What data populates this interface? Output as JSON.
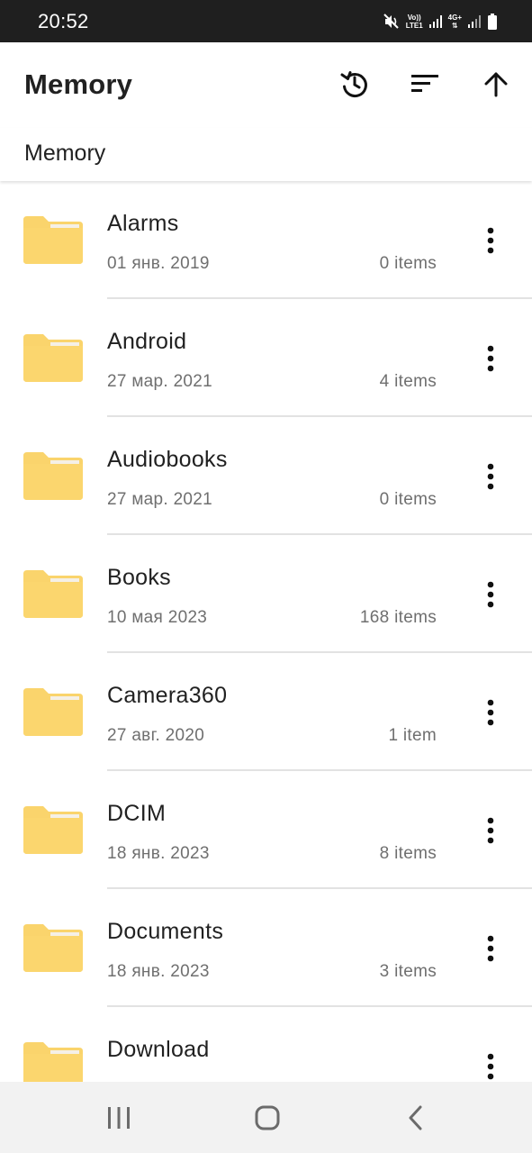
{
  "status_bar": {
    "time": "20:52",
    "network_top": "Vo))",
    "network_bottom": "LTE1",
    "network2_top": "4G+"
  },
  "app_bar": {
    "title": "Memory",
    "actions": [
      "history-icon",
      "sort-icon",
      "arrow-up-icon"
    ]
  },
  "breadcrumb": {
    "path": "Memory"
  },
  "files": [
    {
      "name": "Alarms",
      "date": "01 янв. 2019",
      "count": "0 items"
    },
    {
      "name": "Android",
      "date": "27 мар. 2021",
      "count": "4 items"
    },
    {
      "name": "Audiobooks",
      "date": "27 мар. 2021",
      "count": "0 items"
    },
    {
      "name": "Books",
      "date": "10 мая 2023",
      "count": "168 items"
    },
    {
      "name": "Camera360",
      "date": "27 авг. 2020",
      "count": "1 item"
    },
    {
      "name": "DCIM",
      "date": "18 янв. 2023",
      "count": "8 items"
    },
    {
      "name": "Documents",
      "date": "18 янв. 2023",
      "count": "3 items"
    },
    {
      "name": "Download",
      "date": "",
      "count": ""
    }
  ],
  "colors": {
    "folder": "#fad46c",
    "folder_tab": "#f5f0e6",
    "status_bar_bg": "#1f1f1f",
    "nav_bar_bg": "#f2f2f2"
  },
  "nav_bar": {
    "buttons": [
      "recent-apps-icon",
      "home-icon",
      "back-icon"
    ]
  }
}
